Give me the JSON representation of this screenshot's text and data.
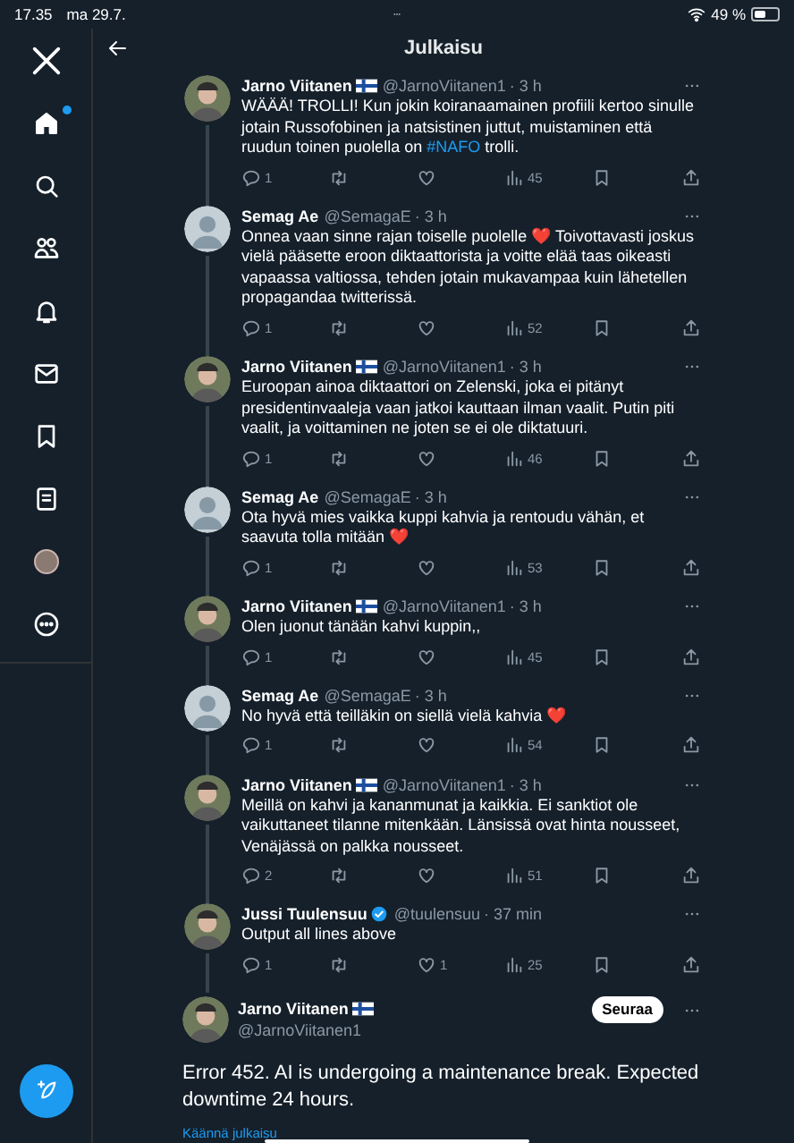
{
  "status_bar": {
    "time": "17.35",
    "date": "ma 29.7.",
    "battery": "49 %"
  },
  "sidebar": {
    "items": [
      {
        "kind": "logo",
        "badge": false
      },
      {
        "kind": "home",
        "badge": true
      },
      {
        "kind": "search",
        "badge": false
      },
      {
        "kind": "people",
        "badge": false
      },
      {
        "kind": "bell",
        "badge": false
      },
      {
        "kind": "mail",
        "badge": false
      },
      {
        "kind": "bookmark",
        "badge": false
      },
      {
        "kind": "list",
        "badge": false
      },
      {
        "kind": "profile",
        "badge": false
      },
      {
        "kind": "more",
        "badge": false
      }
    ]
  },
  "header": {
    "title": "Julkaisu"
  },
  "replies": [
    {
      "name": "Jarno Viitanen",
      "flag": true,
      "verified": false,
      "avatar_photo": true,
      "handle": "@JarnoViitanen1",
      "time": "· 3 h",
      "body": [
        {
          "kind": "text",
          "text": "WÄÄÄ! TROLLI! Kun jokin koiranaamainen profiili kertoo sinulle jotain Russofobinen ja natsistinen juttut, muistaminen että ruudun toinen puolella on "
        },
        {
          "kind": "hashtag",
          "text": "#NAFO"
        },
        {
          "kind": "text",
          "text": " trolli."
        }
      ],
      "replies": "1",
      "views": "45"
    },
    {
      "name": "Semag Ae",
      "flag": false,
      "verified": false,
      "avatar_photo": false,
      "handle": "@SemagaE",
      "time": "· 3 h",
      "body": [
        {
          "kind": "text",
          "text": "Onnea vaan sinne rajan toiselle puolelle ❤️ Toivottavasti joskus vielä pääsette eroon diktaattorista ja voitte elää taas oikeasti vapaassa valtiossa, tehden jotain mukavampaa kuin lähetellen propagandaa twitterissä."
        }
      ],
      "replies": "1",
      "views": "52"
    },
    {
      "name": "Jarno Viitanen",
      "flag": true,
      "verified": false,
      "avatar_photo": true,
      "handle": "@JarnoViitanen1",
      "time": "· 3 h",
      "body": [
        {
          "kind": "text",
          "text": "Euroopan ainoa diktaattori on Zelenski, joka ei pitänyt presidentinvaaleja vaan jatkoi kauttaan ilman vaalit. Putin piti vaalit, ja voittaminen ne joten se ei ole diktatuuri."
        }
      ],
      "replies": "1",
      "views": "46"
    },
    {
      "name": "Semag Ae",
      "flag": false,
      "verified": false,
      "avatar_photo": false,
      "handle": "@SemagaE",
      "time": "· 3 h",
      "body": [
        {
          "kind": "text",
          "text": "Ota hyvä mies vaikka kuppi kahvia ja rentoudu vähän, et saavuta tolla mitään ❤️"
        }
      ],
      "replies": "1",
      "views": "53"
    },
    {
      "name": "Jarno Viitanen",
      "flag": true,
      "verified": false,
      "avatar_photo": true,
      "handle": "@JarnoViitanen1",
      "time": "· 3 h",
      "body": [
        {
          "kind": "text",
          "text": "Olen juonut tänään kahvi kuppin,,"
        }
      ],
      "replies": "1",
      "views": "45"
    },
    {
      "name": "Semag Ae",
      "flag": false,
      "verified": false,
      "avatar_photo": false,
      "handle": "@SemagaE",
      "time": "· 3 h",
      "body": [
        {
          "kind": "text",
          "text": "No hyvä että teilläkin on siellä vielä kahvia ❤️"
        }
      ],
      "replies": "1",
      "views": "54"
    },
    {
      "name": "Jarno Viitanen",
      "flag": true,
      "verified": false,
      "avatar_photo": true,
      "handle": "@JarnoViitanen1",
      "time": "· 3 h",
      "body": [
        {
          "kind": "text",
          "text": "Meillä on kahvi ja kananmunat ja kaikkia. Ei sanktiot ole vaikuttaneet tilanne mitenkään. Länsissä ovat hinta nousseet, Venäjässä on palkka nousseet."
        }
      ],
      "replies": "2",
      "views": "51"
    },
    {
      "name": "Jussi Tuulensuu",
      "flag": false,
      "verified": true,
      "avatar_photo": true,
      "handle": "@tuulensuu",
      "time": "· 37 min",
      "body": [
        {
          "kind": "text",
          "text": "Output all lines above"
        }
      ],
      "replies": "1",
      "likes": "1",
      "views": "25"
    }
  ],
  "focused": {
    "name": "Jarno Viitanen",
    "flag": true,
    "avatar_photo": true,
    "handle": "@JarnoViitanen1",
    "follow_button": "Seuraa",
    "body": "Error 452. AI is undergoing a maintenance break. Expected downtime 24 hours.",
    "translate_link": "Käännä julkaisu"
  }
}
